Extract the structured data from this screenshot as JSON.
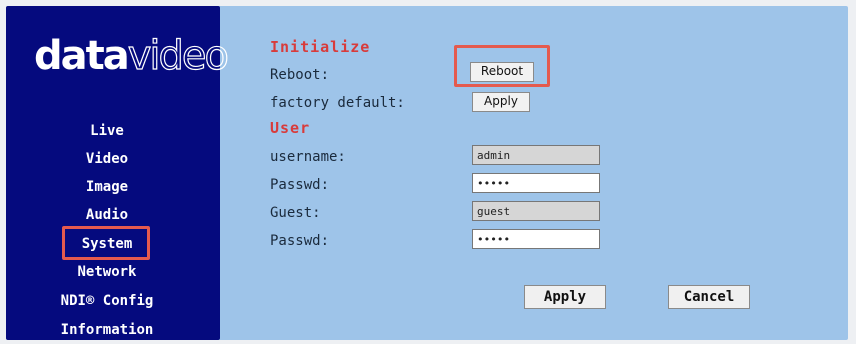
{
  "brand": {
    "logo_bold": "data",
    "logo_light": "video"
  },
  "sidebar": {
    "items": [
      {
        "label": "Live"
      },
      {
        "label": "Video"
      },
      {
        "label": "Image"
      },
      {
        "label": "Audio"
      },
      {
        "label": "System",
        "selected": true
      },
      {
        "label": "Network"
      },
      {
        "label": "NDI® Config"
      },
      {
        "label": "Information"
      }
    ]
  },
  "main": {
    "initialize": {
      "title": "Initialize",
      "reboot_label": "Reboot:",
      "reboot_button": "Reboot",
      "factory_label": "factory default:",
      "factory_button": "Apply"
    },
    "user": {
      "title": "User",
      "username_label": "username:",
      "username_value": "admin",
      "passwd_label": "Passwd:",
      "passwd_value": "•••••",
      "guest_label": "Guest:",
      "guest_value": "guest",
      "guest_passwd_label": "Passwd:",
      "guest_passwd_value": "•••••"
    },
    "footer": {
      "apply": "Apply",
      "cancel": "Cancel"
    }
  },
  "colors": {
    "sidebar_bg": "#050a7e",
    "content_bg": "#9ec4e9",
    "section_title": "#d83b3b",
    "highlight": "#e45a4e"
  }
}
